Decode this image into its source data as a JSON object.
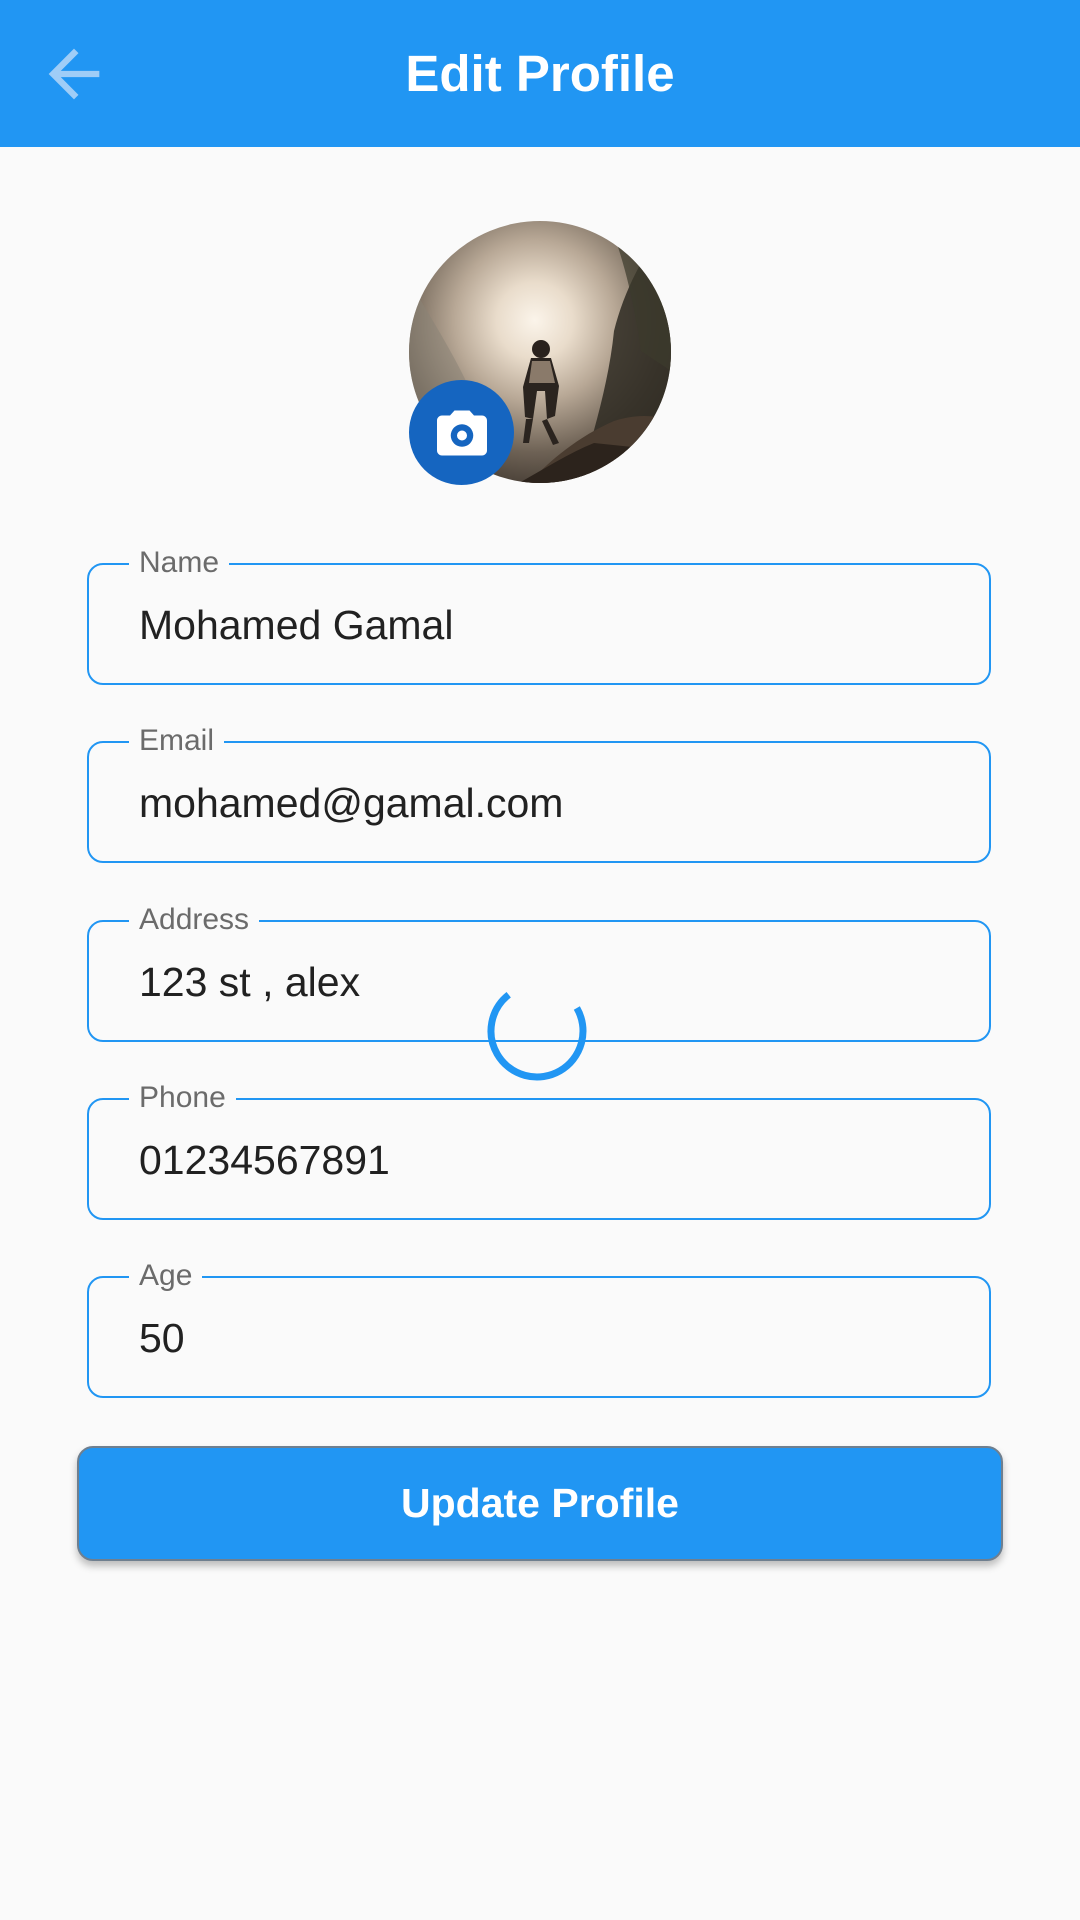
{
  "appbar": {
    "title": "Edit Profile",
    "back_icon": "arrow-back-icon",
    "color": "#2196f3"
  },
  "avatar": {
    "camera_icon": "camera-icon"
  },
  "fields": [
    {
      "label": "Name",
      "value": "Mohamed Gamal"
    },
    {
      "label": "Email",
      "value": "mohamed@gamal.com"
    },
    {
      "label": "Address",
      "value": "123 st , alex"
    },
    {
      "label": "Phone",
      "value": "01234567891"
    },
    {
      "label": "Age",
      "value": "50"
    }
  ],
  "update_button": {
    "label": "Update Profile"
  },
  "colors": {
    "accent": "#2196f3",
    "camera_button": "#1565c0",
    "background": "#fafafa"
  }
}
